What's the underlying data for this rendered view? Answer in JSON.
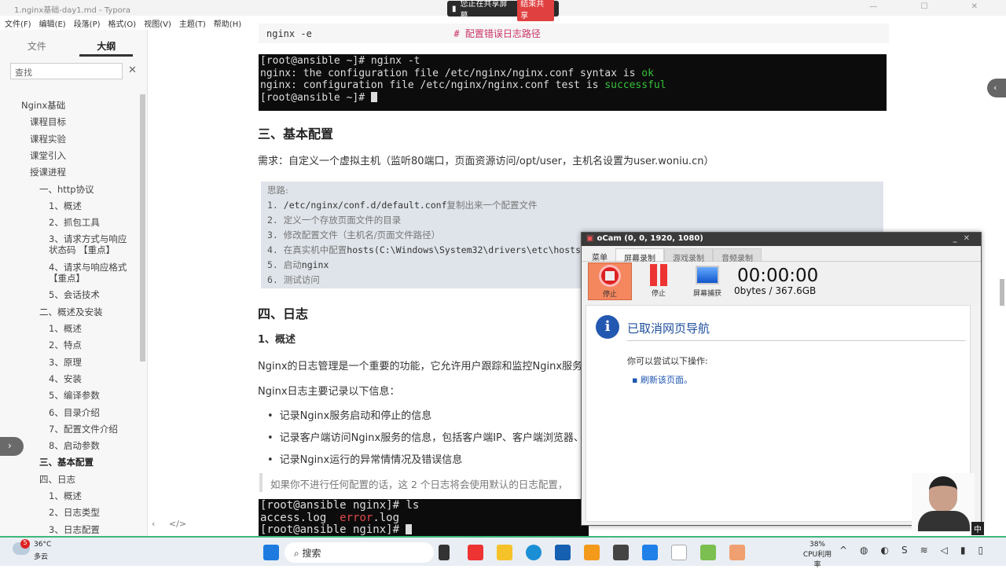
{
  "window": {
    "title": "1.nginx基础-day1.md - Typora",
    "controls": "— ☐ ✕"
  },
  "share_banner": {
    "text": "您正在共享屏幕",
    "end": "结束共享"
  },
  "menu": [
    "文件(F)",
    "编辑(E)",
    "段落(P)",
    "格式(O)",
    "视图(V)",
    "主题(T)",
    "帮助(H)"
  ],
  "sidebar": {
    "tabs": [
      "文件",
      "大纲"
    ],
    "search_placeholder": "查找",
    "outline": [
      {
        "t": "Nginx基础",
        "l": 0
      },
      {
        "t": "课程目标",
        "l": 1
      },
      {
        "t": "课程实验",
        "l": 1
      },
      {
        "t": "课堂引入",
        "l": 1
      },
      {
        "t": "授课进程",
        "l": 1
      },
      {
        "t": "一、http协议",
        "l": 2
      },
      {
        "t": "1、概述",
        "l": 3
      },
      {
        "t": "2、抓包工具",
        "l": 3
      },
      {
        "t": "3、请求方式与响应状态码 【重点】",
        "l": 3
      },
      {
        "t": "4、请求与响应格式【重点】",
        "l": 3
      },
      {
        "t": "5、会话技术",
        "l": 3
      },
      {
        "t": "二、概述及安装",
        "l": 2
      },
      {
        "t": "1、概述",
        "l": 3
      },
      {
        "t": "2、特点",
        "l": 3
      },
      {
        "t": "3、原理",
        "l": 3
      },
      {
        "t": "4、安装",
        "l": 3
      },
      {
        "t": "5、编译参数",
        "l": 3
      },
      {
        "t": "6、目录介绍",
        "l": 3
      },
      {
        "t": "7、配置文件介绍",
        "l": 3
      },
      {
        "t": "8、启动参数",
        "l": 3
      },
      {
        "t": "三、基本配置",
        "l": 2,
        "b": true
      },
      {
        "t": "四、日志",
        "l": 2
      },
      {
        "t": "1、概述",
        "l": 3
      },
      {
        "t": "2、日志类型",
        "l": 3
      },
      {
        "t": "3、日志配置",
        "l": 3
      }
    ],
    "footer": "‹ </>"
  },
  "doc": {
    "top_code": {
      "cmd": "nginx -e",
      "comment": "# 配置错误日志路径"
    },
    "term1": {
      "l1": "[root@ansible ~]# nginx -t",
      "l2a": "nginx: the configuration file /etc/nginx/nginx.conf syntax is ",
      "l2b": "ok",
      "l3a": "nginx: configuration file /etc/nginx/nginx.conf test is ",
      "l3b": "successful",
      "l4": "[root@ansible ~]# "
    },
    "h_basic": "三、基本配置",
    "requirement": "需求：自定义一个虚拟主机（监听80端口，页面资源访问/opt/user，主机名设置为user.woniu.cn）",
    "code": {
      "title": "思路:",
      "lines": [
        {
          "n": "1. ",
          "m": "/etc/nginx/conf.d/default.conf",
          "t": "复制出来一个配置文件"
        },
        {
          "n": "2. ",
          "m": "",
          "t": "定义一个存放页面文件的目录"
        },
        {
          "n": "3. ",
          "m": "",
          "t": "修改配置文件（主机名/页面文件路径）"
        },
        {
          "n": "4. ",
          "m": "",
          "t": "在真实机中配置",
          "m2": "hosts(C:\\Windows\\System32\\drivers\\etc\\hosts)"
        },
        {
          "n": "5. ",
          "m": "",
          "t": "启动",
          "m2": "nginx"
        },
        {
          "n": "6. ",
          "m": "",
          "t": "测试访问"
        }
      ]
    },
    "h_log": "四、日志",
    "h_overview": "1、概述",
    "p1": "Nginx的日志管理是一个重要的功能，它允许用户跟踪和监控Nginx服务",
    "p2": "Nginx日志主要记录以下信息：",
    "bullets": [
      "记录Nginx服务启动和停止的信息",
      "记录客户端访问Nginx服务的信息，包括客户端IP、客户端浏览器、",
      "记录Nginx运行的异常情情况及错误信息"
    ],
    "quote": "如果你不进行任何配置的话，这 2 个日志将会使用默认的日志配置，",
    "term2": {
      "l1": "[root@ansible nginx]# ls",
      "l2a": "access.log  ",
      "l2b": "error",
      ".l2c": ".log",
      "l2c": ".log",
      "l3": "[root@ansible nginx]# "
    }
  },
  "ocam": {
    "title": "oCam (0, 0, 1920, 1080)",
    "tabs": [
      "菜单",
      "屏幕录制",
      "游戏录制",
      "音频录制"
    ],
    "buttons": [
      "停止",
      "停止",
      "屏幕捕获"
    ],
    "timer": "00:00:00",
    "size": "0bytes / 367.6GB",
    "msg_title": "已取消网页导航",
    "msg_hint": "你可以尝试以下操作:",
    "msg_link": "刷新该页面。"
  },
  "taskbar": {
    "weather_badge": "5",
    "temp": "36°C",
    "weather": "多云",
    "search": "搜索",
    "cpu": "38%",
    "cpu_label": "CPU利用率",
    "ime": "中"
  }
}
